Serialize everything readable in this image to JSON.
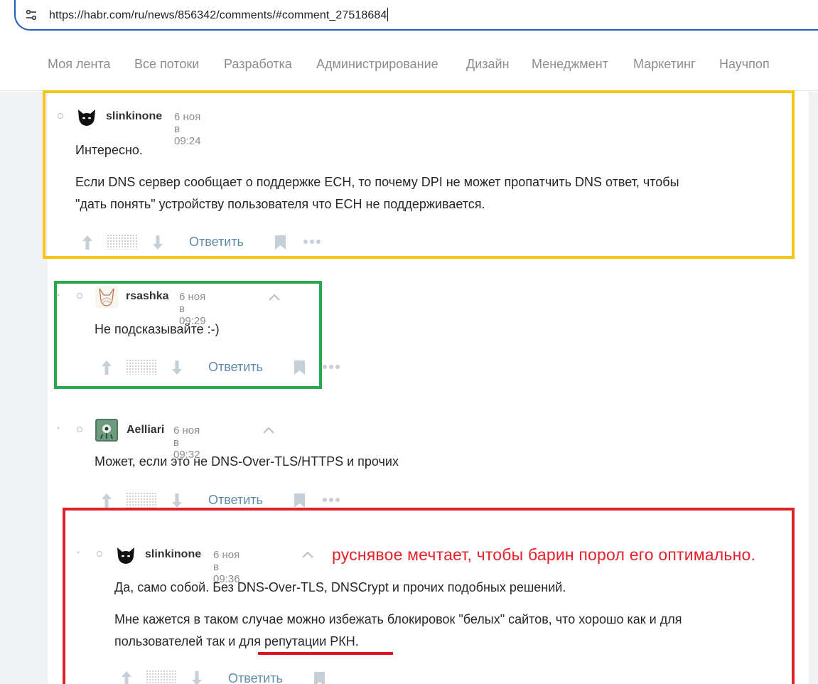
{
  "browser": {
    "url": "https://habr.com/ru/news/856342/comments/#comment_27518684"
  },
  "nav": {
    "items": [
      "Моя лента",
      "Все потоки",
      "Разработка",
      "Администрирование",
      "Дизайн",
      "Менеджмент",
      "Маркетинг",
      "Научпоп"
    ]
  },
  "comments": [
    {
      "user": "slinkinone",
      "time": "6 ноя в 09:24",
      "paragraphs": [
        "Интересно.",
        "Если DNS сервер сообщает о поддержке ECH, то почему DPI не может пропатчить DNS ответ, чтобы",
        "\"дать понять\" устройству пользователя что ECH не поддерживается."
      ],
      "reply_label": "Ответить"
    },
    {
      "user": "rsashka",
      "time": "6 ноя в 09:29",
      "paragraphs": [
        "Не подсказывайте :-)"
      ],
      "reply_label": "Ответить"
    },
    {
      "user": "Aelliari",
      "time": "6 ноя в 09:32",
      "paragraphs": [
        "Может, если это не DNS-Over-TLS/HTTPS и прочих"
      ],
      "reply_label": "Ответить"
    },
    {
      "user": "slinkinone",
      "time": "6 ноя в 09:36",
      "paragraphs": [
        "Да, само собой. Без DNS-Over-TLS, DNSCrypt и прочих подобных решений.",
        "Мне кажется в таком случае можно избежать блокировок \"белых\" сайтов, что хорошо как и для",
        "пользователей так и для репутации РКН."
      ],
      "reply_label": "Ответить"
    }
  ],
  "annotation": {
    "text": "руснявое мечтает, чтобы барин порол его оптимально.",
    "color": "#e8202a"
  },
  "frames": {
    "yellow": "#f5c518",
    "green": "#2aa84a",
    "red": "#e0202a"
  },
  "icons": {
    "url_bar": "site-settings-icon",
    "upvote": "arrow-up-icon",
    "downvote": "arrow-down-icon",
    "bookmark": "bookmark-icon",
    "more": "more-dots-icon",
    "collapse": "chevron-up-icon"
  }
}
